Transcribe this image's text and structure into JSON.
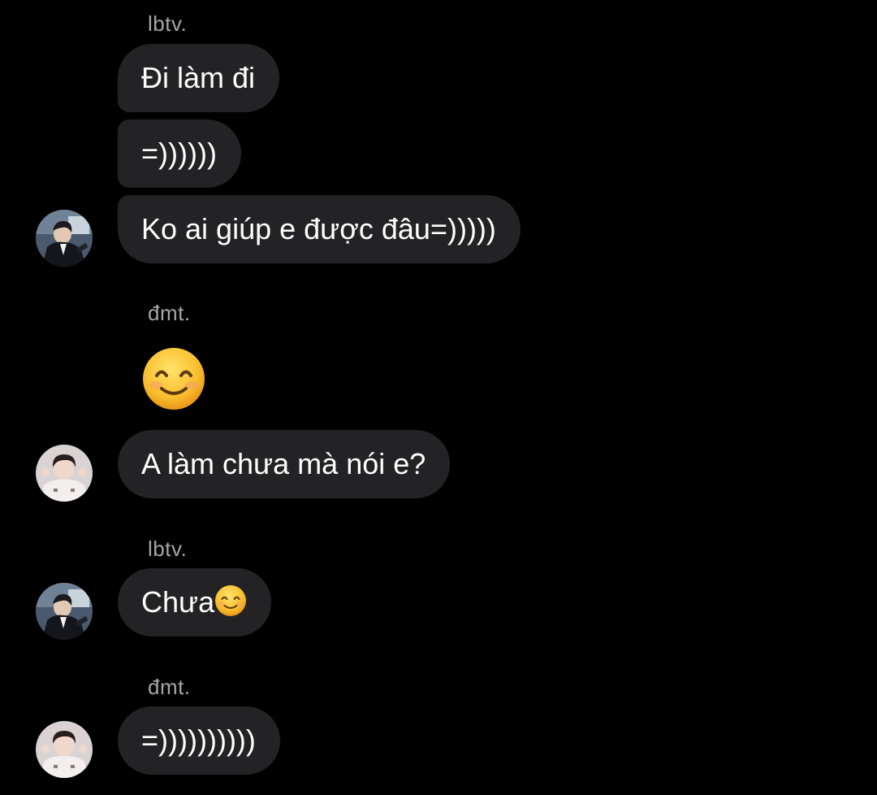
{
  "thread": {
    "senders": {
      "a": "lbtv.",
      "b": "đmt."
    },
    "messages": {
      "m1": "Đi làm đi",
      "m2": "=))))))",
      "m3": "Ko ai giúp e được đâu=)))))",
      "m4_emoji": "smiling-face-icon",
      "m5": "A làm chưa mà nói e?",
      "m6_text": "Chưa",
      "m6_emoji": "smiling-face-icon",
      "m7": "=))))))))))"
    }
  },
  "colors": {
    "background": "#000000",
    "bubble": "#232326",
    "sender_name": "#a6a6a6",
    "text": "#ffffff",
    "emoji_face": "#f7b82b"
  }
}
